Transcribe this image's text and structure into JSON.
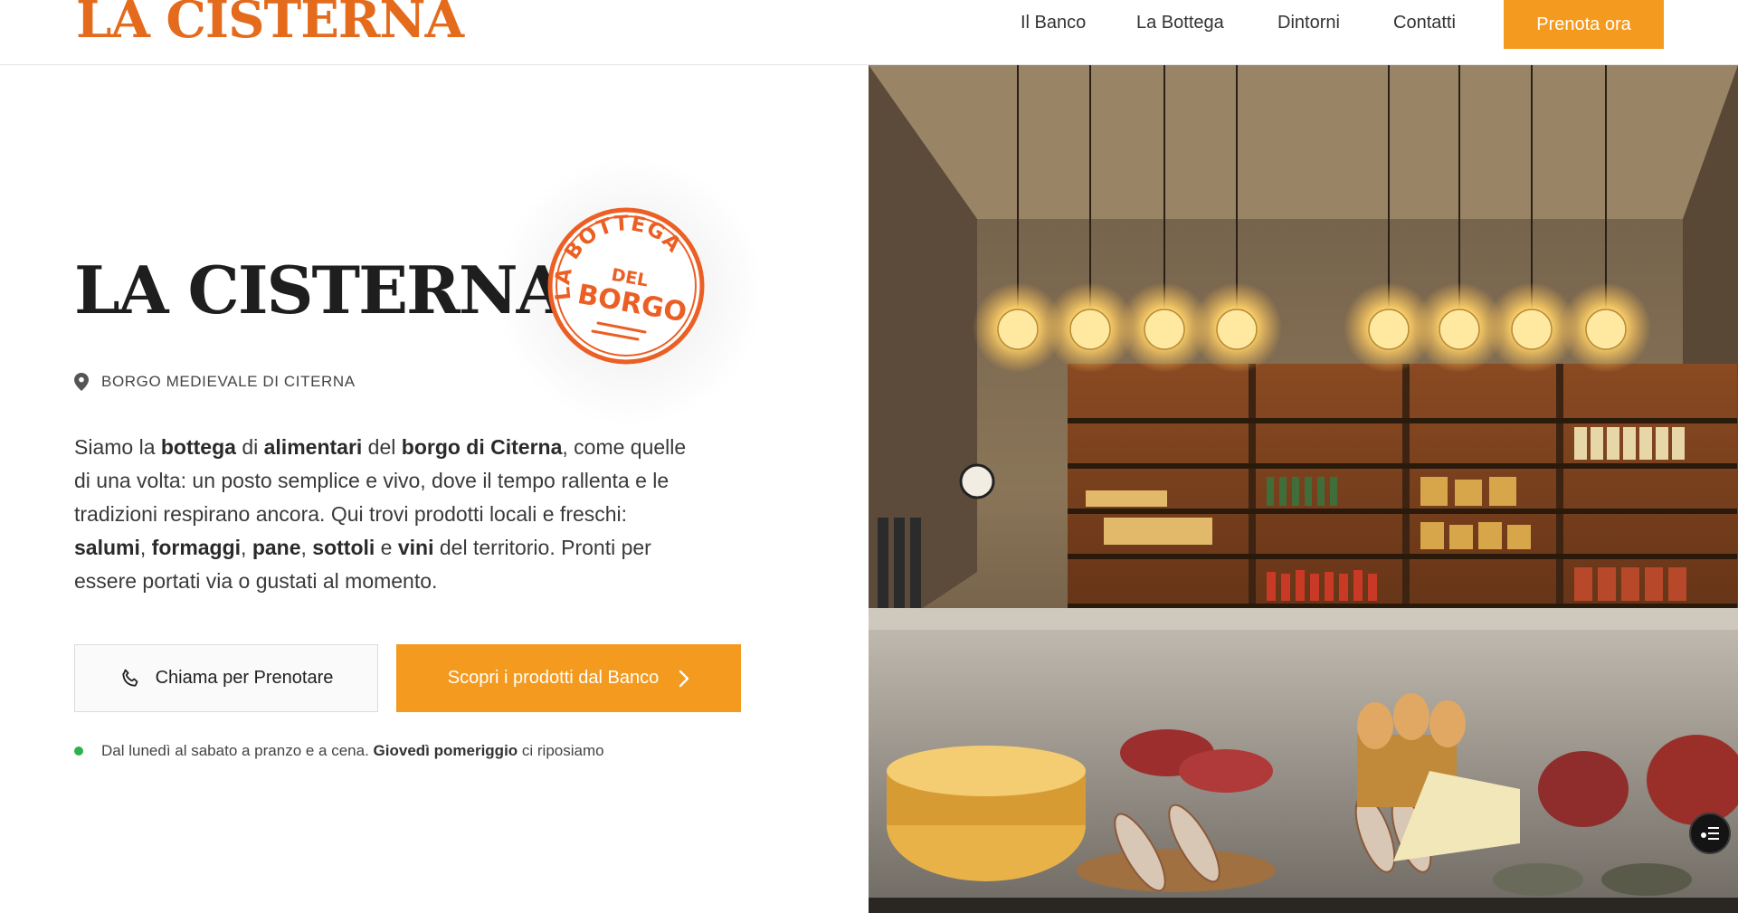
{
  "header": {
    "logo": "LA CISTERNA",
    "nav": [
      {
        "label": "Il Banco"
      },
      {
        "label": "La Bottega"
      },
      {
        "label": "Dintorni"
      },
      {
        "label": "Contatti"
      }
    ],
    "cta": "Prenota ora"
  },
  "hero": {
    "title": "LA CISTERNA",
    "stamp": {
      "top": "LA BOTTEGA",
      "middle": "DEL",
      "bottom": "BORGO"
    },
    "location": "BORGO MEDIEVALE DI CITERNA",
    "description": [
      {
        "t": "Siamo la ",
        "b": false
      },
      {
        "t": "bottega",
        "b": true
      },
      {
        "t": " di ",
        "b": false
      },
      {
        "t": "alimentari",
        "b": true
      },
      {
        "t": " del ",
        "b": false
      },
      {
        "t": "borgo di Citerna",
        "b": true
      },
      {
        "t": ", come quelle di una volta: un posto semplice e vivo, dove il tempo rallenta e le tradizioni respirano ancora. Qui trovi prodotti locali e freschi: ",
        "b": false
      },
      {
        "t": "salumi",
        "b": true
      },
      {
        "t": ", ",
        "b": false
      },
      {
        "t": "formaggi",
        "b": true
      },
      {
        "t": ", ",
        "b": false
      },
      {
        "t": "pane",
        "b": true
      },
      {
        "t": ", ",
        "b": false
      },
      {
        "t": "sottoli",
        "b": true
      },
      {
        "t": " e ",
        "b": false
      },
      {
        "t": "vini",
        "b": true
      },
      {
        "t": " del territorio. Pronti per essere portati via o gustati al momento.",
        "b": false
      }
    ],
    "btn_call": "Chiama per Prenotare",
    "btn_products": "Scopri i prodotti dal Banco",
    "hours_prefix": "Dal lunedì al sabato a pranzo e a cena. ",
    "hours_bold": "Giovedì pomeriggio",
    "hours_suffix": " ci riposiamo"
  },
  "colors": {
    "accent": "#f39a1f",
    "logo": "#e46a1c",
    "status": "#2fb24a"
  },
  "icons": [
    "location-pin-icon",
    "phone-icon",
    "chevron-right-icon",
    "accessibility-menu-icon"
  ]
}
